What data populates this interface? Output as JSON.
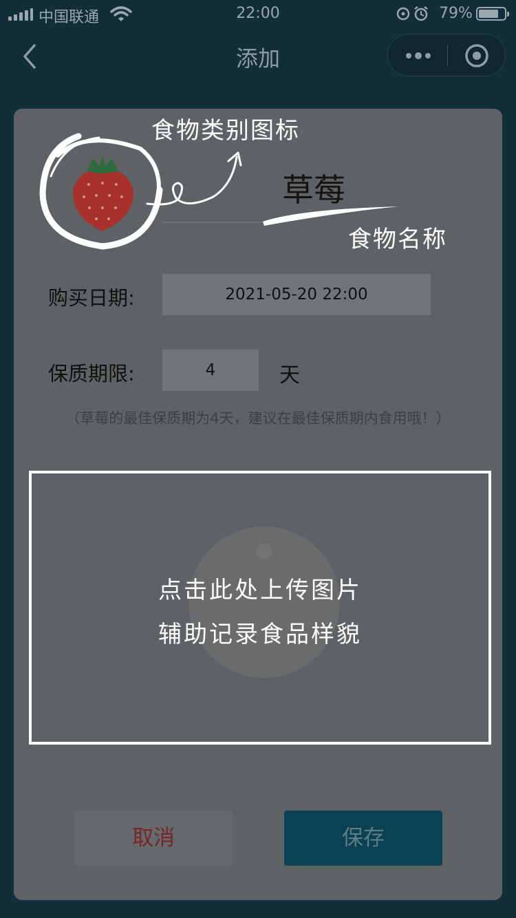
{
  "status_bar": {
    "carrier": "中国联通",
    "time": "22:00",
    "battery": "79%",
    "battery_level": 0.79
  },
  "nav": {
    "title": "添加"
  },
  "form": {
    "food_name": "草莓",
    "purchase_date_label": "购买日期:",
    "purchase_date_value": "2021-05-20 22:00",
    "shelf_life_label": "保质期限:",
    "shelf_life_value": "4",
    "shelf_life_unit": "天",
    "hint": "（草莓的最佳保质期为4天，建议在最佳保质期内食用哦！）"
  },
  "annotations": {
    "category_icon": "食物类别图标",
    "food_name": "食物名称",
    "upload_line1": "点击此处上传图片",
    "upload_line2": "辅助记录食品样貌"
  },
  "buttons": {
    "cancel": "取消",
    "save": "保存"
  },
  "icons": {
    "category": "strawberry-icon",
    "upload": "camera-icon"
  },
  "colors": {
    "background": "#122e3b",
    "card": "#5e6264",
    "cancel_text": "#7a2526",
    "save_button": "#0a4253"
  }
}
